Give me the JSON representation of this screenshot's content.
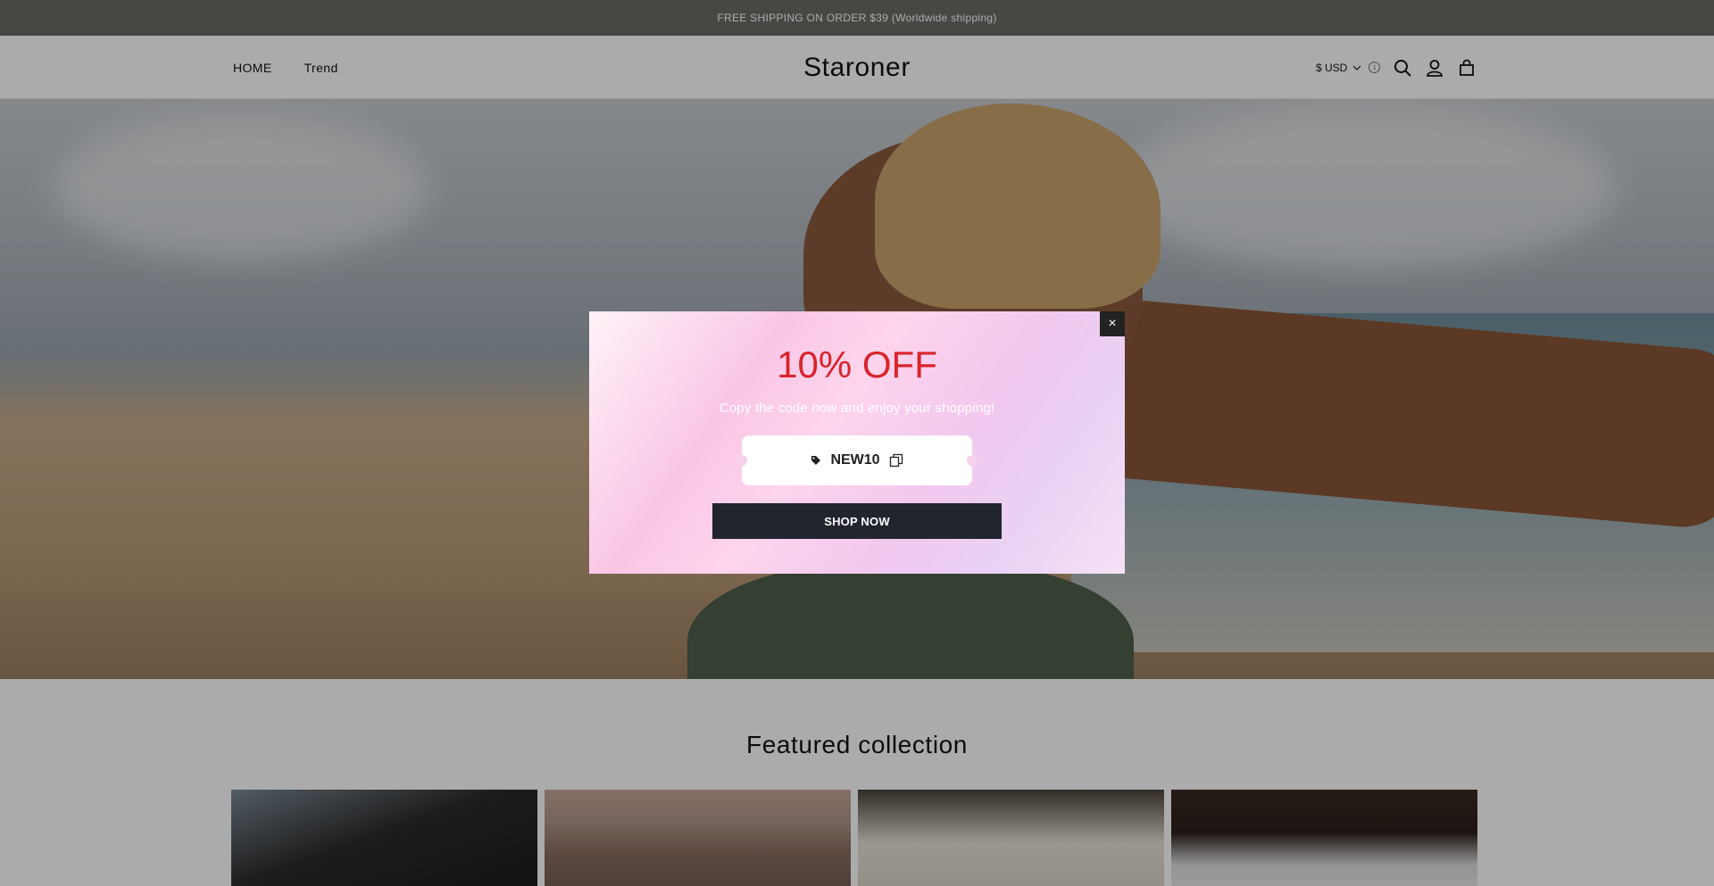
{
  "announcement": {
    "text": "FREE SHIPPING ON ORDER $39 (Worldwide shipping)"
  },
  "header": {
    "nav": [
      {
        "label": "HOME"
      },
      {
        "label": "Trend"
      }
    ],
    "logo": "Staroner",
    "currency": "$ USD",
    "icons": [
      "info-icon",
      "search-icon",
      "account-icon",
      "cart-icon"
    ]
  },
  "featured": {
    "title": "Featured collection"
  },
  "popup": {
    "title": "10% OFF",
    "subtitle": "Copy the code now and enjoy your shopping!",
    "code": "NEW10",
    "button_label": "SHOP NOW",
    "close_label": "×",
    "title_color": "#d9232b"
  }
}
